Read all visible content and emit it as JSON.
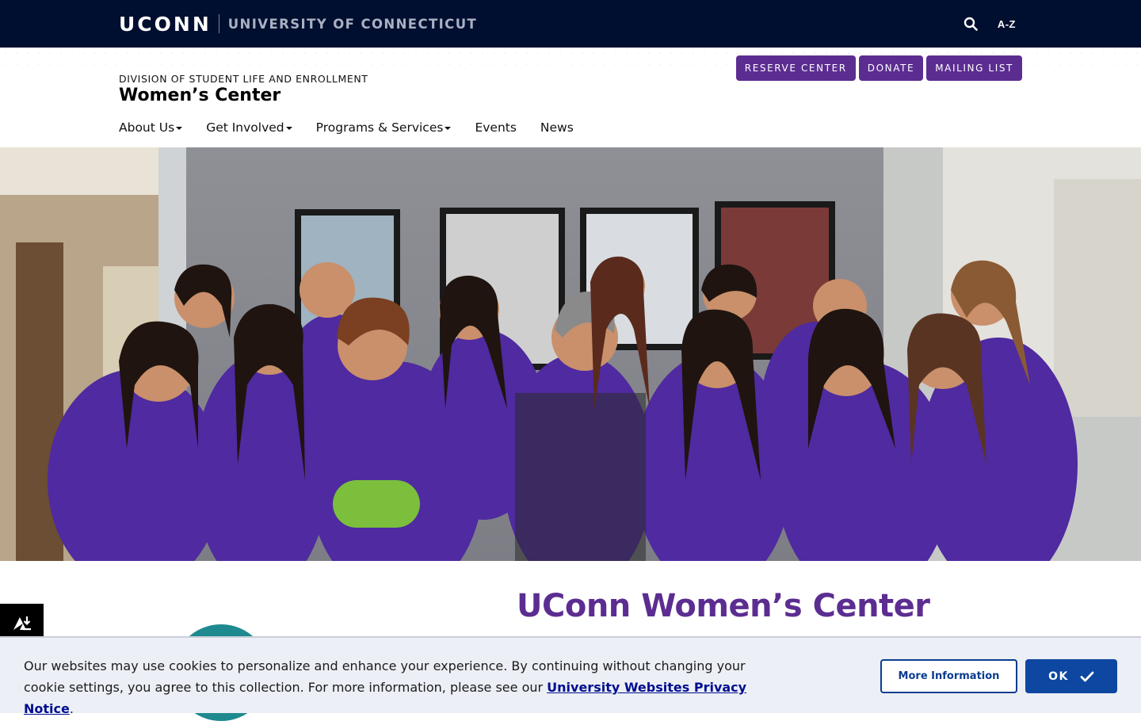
{
  "topbar": {
    "brand": "UCONN",
    "university": "UNIVERSITY OF CONNECTICUT",
    "search_icon": "search-icon",
    "az_label": "A-Z"
  },
  "header": {
    "division": "DIVISION OF STUDENT LIFE AND ENROLLMENT",
    "site_title": "Women’s Center",
    "utility_links": [
      "RESERVE CENTER",
      "DONATE",
      "MAILING LIST"
    ],
    "nav": [
      "About Us",
      "Get Involved",
      "Programs & Services",
      "Events",
      "News"
    ]
  },
  "main": {
    "heading": "UConn Women’s Center"
  },
  "cookie_banner": {
    "text_before": "Our websites may use cookies to personalize and enhance your experience. By continuing without changing your cookie settings, you agree to this collection. For more information, please see our ",
    "link_text": "University Websites Privacy Notice",
    "text_after": ".",
    "more_info_label": "More Information",
    "ok_label": "OK"
  },
  "colors": {
    "topbar": "#000e2f",
    "accent_purple": "#5c2d91",
    "button_blue": "#0d47a1"
  }
}
